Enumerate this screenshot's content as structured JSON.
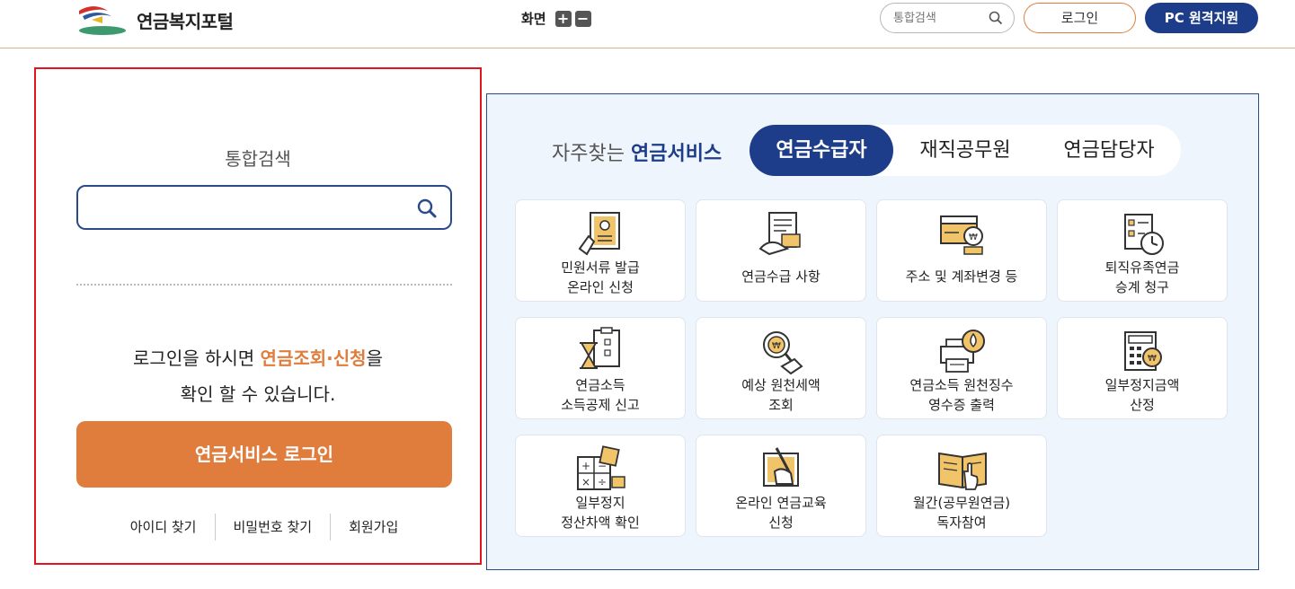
{
  "header": {
    "logo_text": "연금복지포털",
    "zoom_label": "화면",
    "zoom_in": "+",
    "zoom_out": "−",
    "search_placeholder": "통합검색",
    "login_label": "로그인",
    "remote_label": "PC 원격지원"
  },
  "left_panel": {
    "search_title": "통합검색",
    "search_value": "",
    "message_prefix": "로그인을 하시면 ",
    "message_highlight": "연금조회·신청",
    "message_suffix": "을",
    "message_line2": "확인 할 수 있습니다.",
    "login_button": "연금서비스 로그인",
    "links": [
      "아이디 찾기",
      "비밀번호 찾기",
      "회원가입"
    ]
  },
  "right_panel": {
    "title_prefix": "자주찾는 ",
    "title_highlight": "연금서비스",
    "tabs": [
      "연금수급자",
      "재직공무원",
      "연금담당자"
    ],
    "active_tab": "연금수급자",
    "tiles": [
      {
        "line1": "민원서류 발급",
        "line2": "온라인 신청",
        "icon": "document-certificate-icon"
      },
      {
        "line1": "연금수급 사항",
        "line2": "",
        "icon": "document-hand-icon"
      },
      {
        "line1": "주소 및 계좌변경 등",
        "line2": "",
        "icon": "card-coin-icon"
      },
      {
        "line1": "퇴직유족연금",
        "line2": "승계 청구",
        "icon": "checklist-clock-icon"
      },
      {
        "line1": "연금소득",
        "line2": "소득공제 신고",
        "icon": "hourglass-checklist-icon"
      },
      {
        "line1": "예상 원천세액",
        "line2": "조회",
        "icon": "magnifier-coin-icon"
      },
      {
        "line1": "연금소득 원천징수",
        "line2": "영수증 출력",
        "icon": "printer-drop-icon"
      },
      {
        "line1": "일부정지금액",
        "line2": "산정",
        "icon": "calculator-coin-icon"
      },
      {
        "line1": "일부정지",
        "line2": "정산차액 확인",
        "icon": "math-symbols-icon"
      },
      {
        "line1": "온라인 연금교육",
        "line2": "신청",
        "icon": "pen-hand-icon"
      },
      {
        "line1": "월간(공무원연금)",
        "line2": "독자참여",
        "icon": "book-pointer-icon"
      }
    ]
  },
  "colors": {
    "accent_orange": "#e07d3c",
    "brand_navy": "#1d3d8a",
    "panel_bg": "#eef5fc",
    "highlight_border": "#e1161b"
  }
}
